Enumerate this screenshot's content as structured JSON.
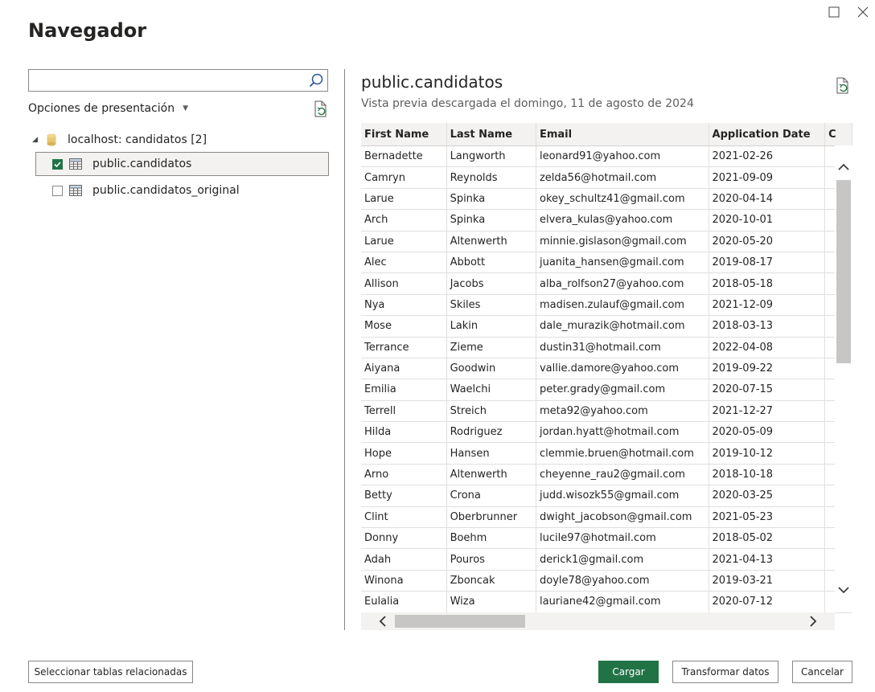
{
  "title": "Navegador",
  "search": {
    "placeholder": "",
    "value": ""
  },
  "options_label": "Opciones de presentación",
  "tree": {
    "root_label": "localhost: candidatos [2]",
    "items": [
      {
        "label": "public.candidatos",
        "checked": true,
        "selected": true
      },
      {
        "label": "public.candidatos_original",
        "checked": false,
        "selected": false
      }
    ]
  },
  "preview": {
    "title": "public.candidatos",
    "subtitle": "Vista previa descargada el domingo, 11 de agosto de 2024",
    "columns": [
      "First Name",
      "Last Name",
      "Email",
      "Application Date",
      "C"
    ],
    "rows": [
      [
        "Bernadette",
        "Langworth",
        "leonard91@yahoo.com",
        "2021-02-26"
      ],
      [
        "Camryn",
        "Reynolds",
        "zelda56@hotmail.com",
        "2021-09-09"
      ],
      [
        "Larue",
        "Spinka",
        "okey_schultz41@gmail.com",
        "2020-04-14"
      ],
      [
        "Arch",
        "Spinka",
        "elvera_kulas@yahoo.com",
        "2020-10-01"
      ],
      [
        "Larue",
        "Altenwerth",
        "minnie.gislason@gmail.com",
        "2020-05-20"
      ],
      [
        "Alec",
        "Abbott",
        "juanita_hansen@gmail.com",
        "2019-08-17"
      ],
      [
        "Allison",
        "Jacobs",
        "alba_rolfson27@yahoo.com",
        "2018-05-18"
      ],
      [
        "Nya",
        "Skiles",
        "madisen.zulauf@gmail.com",
        "2021-12-09"
      ],
      [
        "Mose",
        "Lakin",
        "dale_murazik@hotmail.com",
        "2018-03-13"
      ],
      [
        "Terrance",
        "Zieme",
        "dustin31@hotmail.com",
        "2022-04-08"
      ],
      [
        "Aiyana",
        "Goodwin",
        "vallie.damore@yahoo.com",
        "2019-09-22"
      ],
      [
        "Emilia",
        "Waelchi",
        "peter.grady@gmail.com",
        "2020-07-15"
      ],
      [
        "Terrell",
        "Streich",
        "meta92@yahoo.com",
        "2021-12-27"
      ],
      [
        "Hilda",
        "Rodriguez",
        "jordan.hyatt@hotmail.com",
        "2020-05-09"
      ],
      [
        "Hope",
        "Hansen",
        "clemmie.bruen@hotmail.com",
        "2019-10-12"
      ],
      [
        "Arno",
        "Altenwerth",
        "cheyenne_rau2@gmail.com",
        "2018-10-18"
      ],
      [
        "Betty",
        "Crona",
        "judd.wisozk55@gmail.com",
        "2020-03-25"
      ],
      [
        "Clint",
        "Oberbrunner",
        "dwight_jacobson@gmail.com",
        "2021-05-23"
      ],
      [
        "Donny",
        "Boehm",
        "lucile97@hotmail.com",
        "2018-05-02"
      ],
      [
        "Adah",
        "Pouros",
        "derick1@gmail.com",
        "2021-04-13"
      ],
      [
        "Winona",
        "Zboncak",
        "doyle78@yahoo.com",
        "2019-03-21"
      ],
      [
        "Eulalia",
        "Wiza",
        "lauriane42@gmail.com",
        "2020-07-12"
      ]
    ]
  },
  "buttons": {
    "related": "Seleccionar tablas relacionadas",
    "load": "Cargar",
    "transform": "Transformar datos",
    "cancel": "Cancelar"
  },
  "icons": {
    "maximize": "maximize-icon",
    "close": "close-icon",
    "search": "search-icon",
    "refresh": "refresh-icon",
    "database": "database-icon",
    "table": "table-icon"
  },
  "colors": {
    "accent": "#217346",
    "border": "#8a8886",
    "header_bg": "#f3f2f1",
    "db_icon": "#e8c872"
  }
}
